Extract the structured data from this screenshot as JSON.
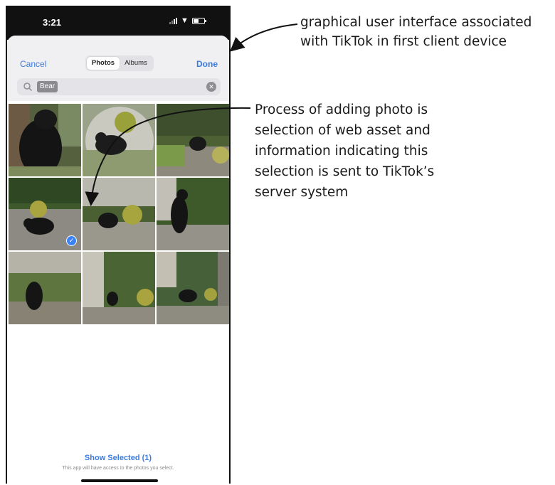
{
  "status_bar": {
    "time": "3:21"
  },
  "picker": {
    "cancel_label": "Cancel",
    "done_label": "Done",
    "tabs": [
      {
        "label": "Photos",
        "active": true
      },
      {
        "label": "Albums",
        "active": false
      }
    ],
    "search": {
      "query": "Bear"
    },
    "photos": [
      {
        "subject": "bear",
        "selected": false
      },
      {
        "subject": "bear",
        "selected": false
      },
      {
        "subject": "bear",
        "selected": false
      },
      {
        "subject": "bear",
        "selected": true
      },
      {
        "subject": "bear",
        "selected": false
      },
      {
        "subject": "bear",
        "selected": false
      },
      {
        "subject": "bear",
        "selected": false
      },
      {
        "subject": "bear",
        "selected": false
      },
      {
        "subject": "bear",
        "selected": false
      }
    ],
    "show_selected_label": "Show Selected (1)",
    "access_note": "This app will have access to the photos you select."
  },
  "annotations": {
    "gui_label": "graphical user interface associated with TikTok in first client device",
    "process_label": "Process of adding photo is selection of web asset and information indicating this selection is sent to TikTok’s server system"
  },
  "colors": {
    "accent": "#3b7be0",
    "checkmark": "#3b82f6"
  }
}
